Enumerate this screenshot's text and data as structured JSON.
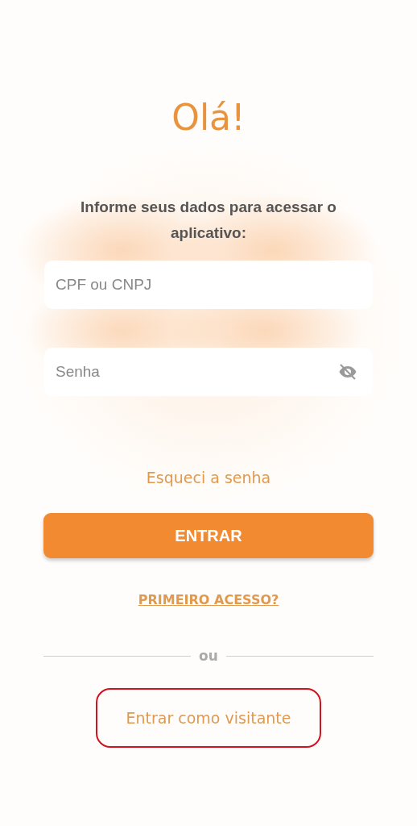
{
  "title": "Olá!",
  "subtitle": "Informe seus dados para acessar o aplicativo:",
  "fields": [
    {
      "kind": "text",
      "placeholder": "CPF ou CNPJ"
    },
    {
      "kind": "password",
      "placeholder": "Senha",
      "password_visible": false
    }
  ],
  "forgot_link": "Esqueci a senha",
  "login_button": "ENTRAR",
  "first_access_link": "PRIMEIRO ACESSO?",
  "divider_text": "ou",
  "guest_link": {
    "label": "Entrar como visitante",
    "highlighted": true
  }
}
